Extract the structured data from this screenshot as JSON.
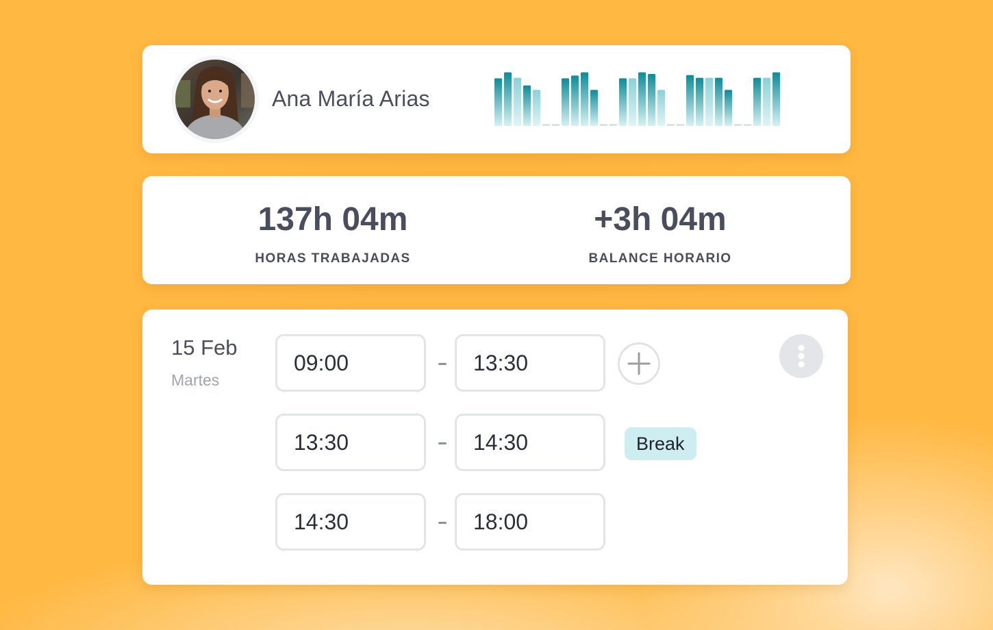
{
  "user": {
    "name": "Ana María Arias"
  },
  "activity_chart": {
    "type": "bar",
    "colors": {
      "bar_top": "#128A95",
      "bar_bottom": "#D7F1F3",
      "bar_light_top": "#8DD0D6",
      "bar_light_bottom": "#E1F4F6",
      "empty_day": "#DCE3E5"
    },
    "weeks": [
      [
        {
          "value": 0.87,
          "tone": "dark"
        },
        {
          "value": 0.98,
          "tone": "dark"
        },
        {
          "value": 0.88,
          "tone": "light"
        },
        {
          "value": 0.74,
          "tone": "dark"
        },
        {
          "value": 0.66,
          "tone": "light"
        },
        {
          "value": 0,
          "tone": "empty"
        },
        {
          "value": 0,
          "tone": "empty"
        }
      ],
      [
        {
          "value": 0.87,
          "tone": "dark"
        },
        {
          "value": 0.92,
          "tone": "dark"
        },
        {
          "value": 0.98,
          "tone": "dark"
        },
        {
          "value": 0.66,
          "tone": "dark"
        },
        {
          "value": 0,
          "tone": "empty"
        },
        {
          "value": 0,
          "tone": "empty"
        }
      ],
      [
        {
          "value": 0.87,
          "tone": "dark"
        },
        {
          "value": 0.87,
          "tone": "light"
        },
        {
          "value": 0.98,
          "tone": "dark"
        },
        {
          "value": 0.95,
          "tone": "dark"
        },
        {
          "value": 0.66,
          "tone": "light"
        },
        {
          "value": 0,
          "tone": "empty"
        },
        {
          "value": 0,
          "tone": "empty"
        }
      ],
      [
        {
          "value": 0.93,
          "tone": "dark"
        },
        {
          "value": 0.88,
          "tone": "dark"
        },
        {
          "value": 0.88,
          "tone": "light"
        },
        {
          "value": 0.88,
          "tone": "dark"
        },
        {
          "value": 0.66,
          "tone": "dark"
        },
        {
          "value": 0,
          "tone": "empty"
        },
        {
          "value": 0,
          "tone": "empty"
        }
      ],
      [
        {
          "value": 0.88,
          "tone": "dark"
        },
        {
          "value": 0.88,
          "tone": "light"
        },
        {
          "value": 0.98,
          "tone": "dark"
        }
      ]
    ]
  },
  "stats": {
    "worked": {
      "value": "137h 04m",
      "label": "HORAS TRABAJADAS"
    },
    "balance": {
      "value": "+3h 04m",
      "label": "BALANCE HORARIO"
    }
  },
  "day": {
    "date": "15 Feb",
    "weekday": "Martes",
    "entries": [
      {
        "start": "09:00",
        "end": "13:30"
      },
      {
        "start": "13:30",
        "end": "14:30",
        "badge": "Break"
      },
      {
        "start": "14:30",
        "end": "18:00"
      }
    ]
  },
  "icons": {
    "add": "plus-icon",
    "more": "more-vertical-icon"
  }
}
